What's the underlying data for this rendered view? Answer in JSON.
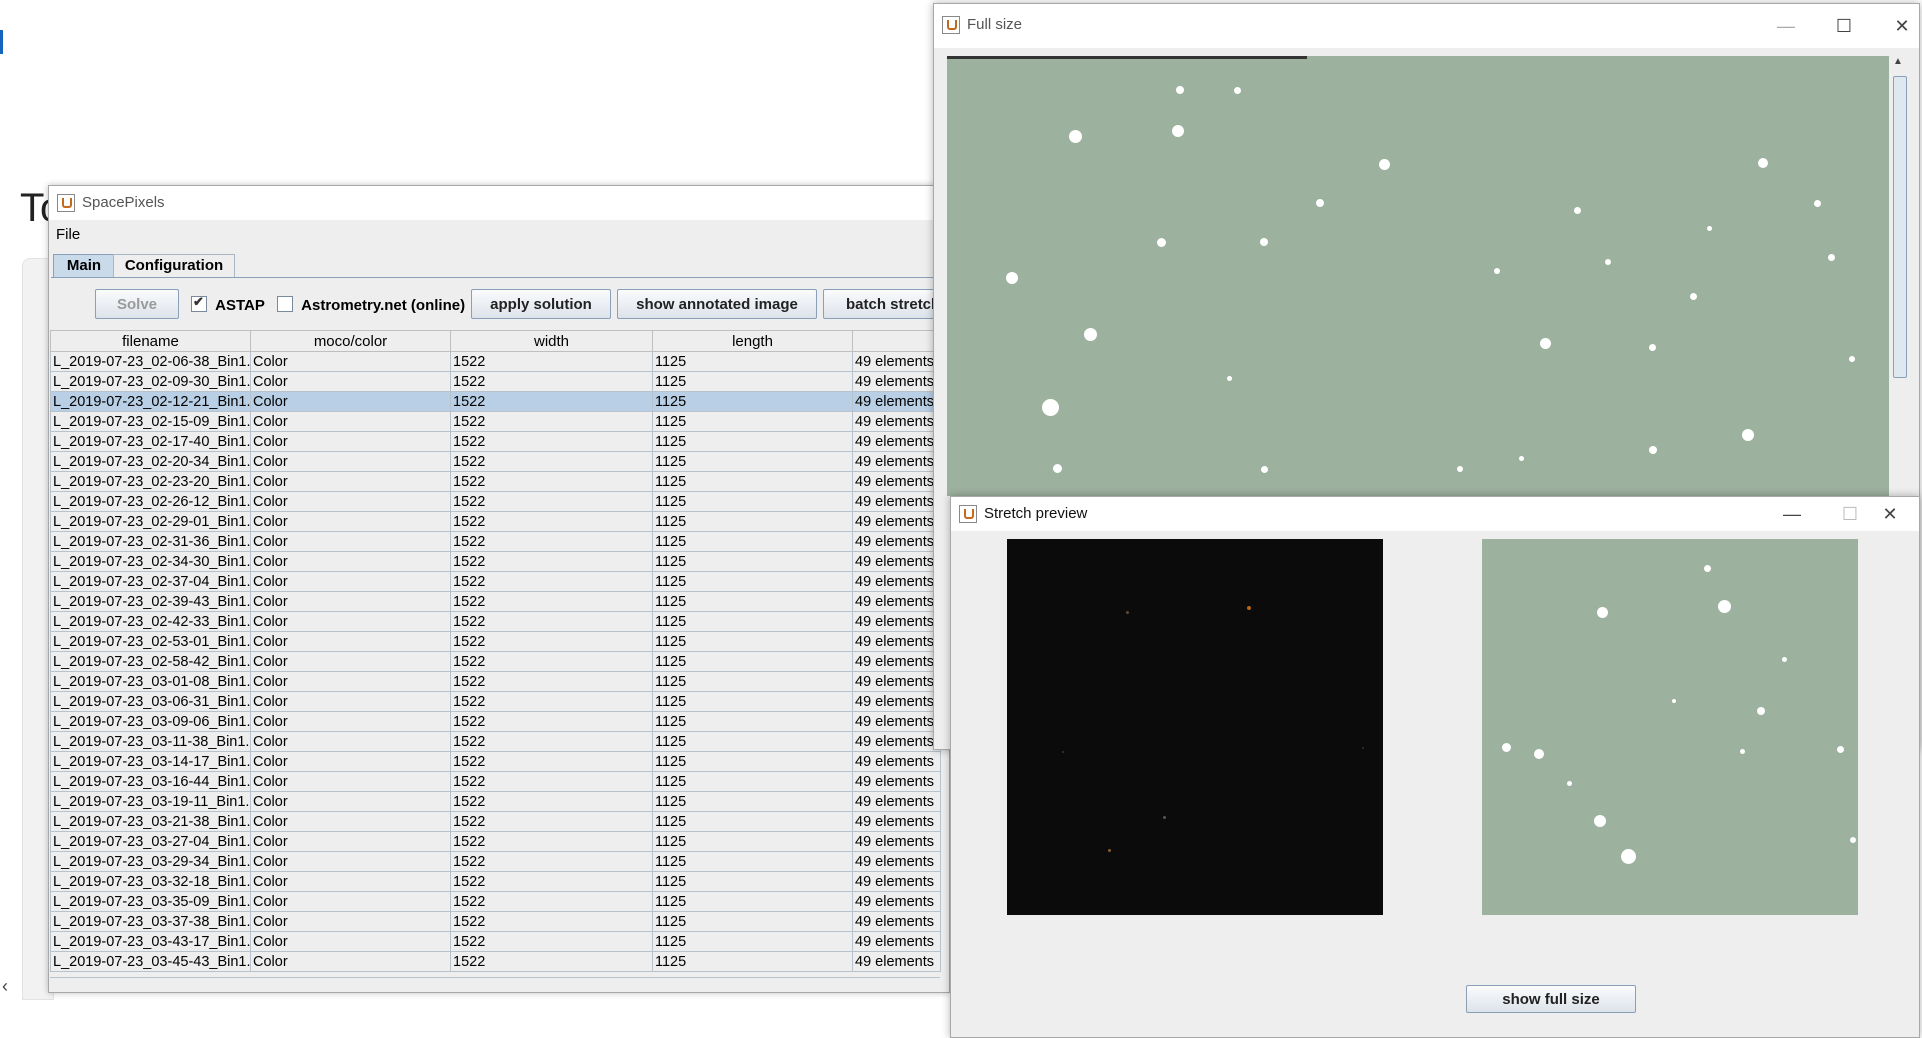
{
  "spacepixels": {
    "title": "SpacePixels",
    "menu": [
      "File"
    ],
    "tabs": [
      "Main",
      "Configuration"
    ],
    "toolbar": {
      "solve": "Solve",
      "astap": "ASTAP",
      "astap_checked": true,
      "astrometry": "Astrometry.net (online)",
      "astrometry_checked": false,
      "apply": "apply solution",
      "annotated": "show annotated image",
      "batch": "batch stretch"
    },
    "columns": [
      "filename",
      "moco/color",
      "width",
      "length",
      ""
    ],
    "rows": [
      [
        "L_2019-07-23_02-06-38_Bin1.",
        "Color",
        "1522",
        "1125",
        "49 elements"
      ],
      [
        "L_2019-07-23_02-09-30_Bin1.",
        "Color",
        "1522",
        "1125",
        "49 elements"
      ],
      [
        "L_2019-07-23_02-12-21_Bin1.",
        "Color",
        "1522",
        "1125",
        "49 elements"
      ],
      [
        "L_2019-07-23_02-15-09_Bin1.",
        "Color",
        "1522",
        "1125",
        "49 elements"
      ],
      [
        "L_2019-07-23_02-17-40_Bin1.",
        "Color",
        "1522",
        "1125",
        "49 elements"
      ],
      [
        "L_2019-07-23_02-20-34_Bin1.",
        "Color",
        "1522",
        "1125",
        "49 elements"
      ],
      [
        "L_2019-07-23_02-23-20_Bin1.",
        "Color",
        "1522",
        "1125",
        "49 elements"
      ],
      [
        "L_2019-07-23_02-26-12_Bin1.",
        "Color",
        "1522",
        "1125",
        "49 elements"
      ],
      [
        "L_2019-07-23_02-29-01_Bin1.",
        "Color",
        "1522",
        "1125",
        "49 elements"
      ],
      [
        "L_2019-07-23_02-31-36_Bin1.",
        "Color",
        "1522",
        "1125",
        "49 elements"
      ],
      [
        "L_2019-07-23_02-34-30_Bin1.",
        "Color",
        "1522",
        "1125",
        "49 elements"
      ],
      [
        "L_2019-07-23_02-37-04_Bin1.",
        "Color",
        "1522",
        "1125",
        "49 elements"
      ],
      [
        "L_2019-07-23_02-39-43_Bin1.",
        "Color",
        "1522",
        "1125",
        "49 elements"
      ],
      [
        "L_2019-07-23_02-42-33_Bin1.",
        "Color",
        "1522",
        "1125",
        "49 elements"
      ],
      [
        "L_2019-07-23_02-53-01_Bin1.",
        "Color",
        "1522",
        "1125",
        "49 elements"
      ],
      [
        "L_2019-07-23_02-58-42_Bin1.",
        "Color",
        "1522",
        "1125",
        "49 elements"
      ],
      [
        "L_2019-07-23_03-01-08_Bin1.",
        "Color",
        "1522",
        "1125",
        "49 elements"
      ],
      [
        "L_2019-07-23_03-06-31_Bin1.",
        "Color",
        "1522",
        "1125",
        "49 elements"
      ],
      [
        "L_2019-07-23_03-09-06_Bin1.",
        "Color",
        "1522",
        "1125",
        "49 elements"
      ],
      [
        "L_2019-07-23_03-11-38_Bin1.",
        "Color",
        "1522",
        "1125",
        "49 elements"
      ],
      [
        "L_2019-07-23_03-14-17_Bin1.",
        "Color",
        "1522",
        "1125",
        "49 elements"
      ],
      [
        "L_2019-07-23_03-16-44_Bin1.",
        "Color",
        "1522",
        "1125",
        "49 elements"
      ],
      [
        "L_2019-07-23_03-19-11_Bin1.",
        "Color",
        "1522",
        "1125",
        "49 elements"
      ],
      [
        "L_2019-07-23_03-21-38_Bin1.",
        "Color",
        "1522",
        "1125",
        "49 elements"
      ],
      [
        "L_2019-07-23_03-27-04_Bin1.",
        "Color",
        "1522",
        "1125",
        "49 elements"
      ],
      [
        "L_2019-07-23_03-29-34_Bin1.",
        "Color",
        "1522",
        "1125",
        "49 elements"
      ],
      [
        "L_2019-07-23_03-32-18_Bin1.",
        "Color",
        "1522",
        "1125",
        "49 elements"
      ],
      [
        "L_2019-07-23_03-35-09_Bin1.",
        "Color",
        "1522",
        "1125",
        "49 elements"
      ],
      [
        "L_2019-07-23_03-37-38_Bin1.",
        "Color",
        "1522",
        "1125",
        "49 elements"
      ],
      [
        "L_2019-07-23_03-43-17_Bin1.",
        "Color",
        "1522",
        "1125",
        "49 elements"
      ],
      [
        "L_2019-07-23_03-45-43_Bin1.",
        "Color",
        "1522",
        "1125",
        "49 elements"
      ]
    ],
    "selected_row": 2
  },
  "background_text": "To",
  "fullsize": {
    "title": "Full size",
    "controls": {
      "minimize": "—",
      "maximize": "☐",
      "close": "✕"
    }
  },
  "stretch": {
    "title": "Stretch preview",
    "controls": {
      "minimize": "—",
      "maximize": "☐",
      "close": "✕"
    },
    "button": "show full size"
  },
  "colors": {
    "sky": "#9db19f",
    "selection": "#b8cfe5",
    "dark_preview": "#0b0b0b"
  },
  "icons": [
    "java-cup-icon",
    "minimize-icon",
    "maximize-icon",
    "close-icon",
    "checkbox-icon",
    "scroll-left-arrow-icon",
    "scroll-up-arrow-icon"
  ]
}
